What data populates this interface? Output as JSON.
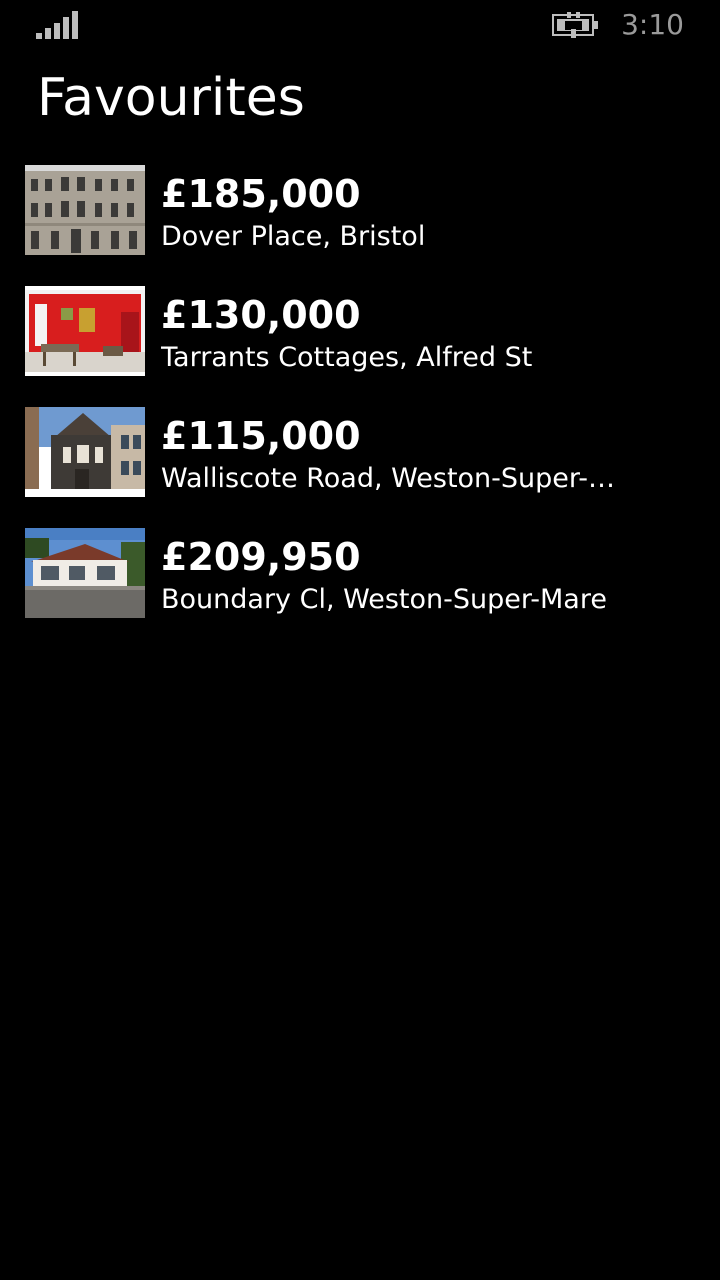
{
  "status_bar": {
    "signal_icon": "signal-strength-icon",
    "battery_icon": "battery-charging-icon",
    "time": "3:10"
  },
  "page": {
    "title": "Favourites"
  },
  "listings": [
    {
      "price": "£185,000",
      "address": "Dover Place, Bristol",
      "photo": "terraced-building-photo"
    },
    {
      "price": "£130,000",
      "address": "Tarrants Cottages, Alfred St",
      "photo": "red-room-interior-photo"
    },
    {
      "price": "£115,000",
      "address": "Walliscote Road, Weston-Super-…",
      "photo": "chapel-building-photo"
    },
    {
      "price": "£209,950",
      "address": "Boundary Cl, Weston-Super-Mare",
      "photo": "bungalow-photo"
    }
  ]
}
